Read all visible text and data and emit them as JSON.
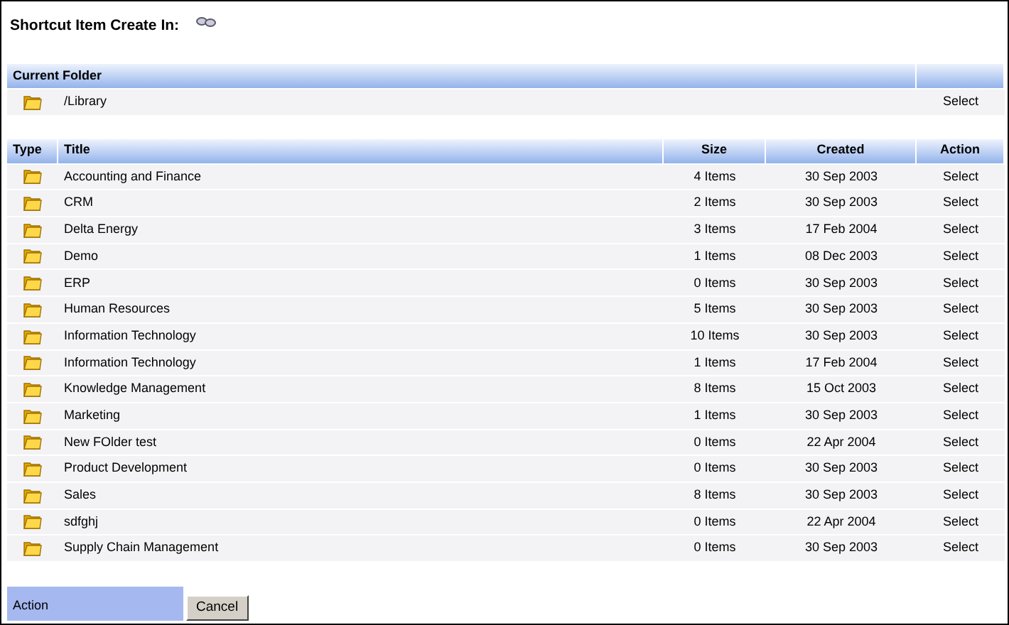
{
  "title": "Shortcut Item Create In:",
  "current_folder": {
    "heading": "Current Folder",
    "path": "/Library",
    "action": "Select"
  },
  "table": {
    "columns": [
      "Type",
      "Title",
      "Size",
      "Created",
      "Action"
    ],
    "rows": [
      {
        "title": "Accounting and Finance",
        "size": "4 Items",
        "created": "30 Sep 2003",
        "action": "Select"
      },
      {
        "title": "CRM",
        "size": "2 Items",
        "created": "30 Sep 2003",
        "action": "Select"
      },
      {
        "title": "Delta Energy",
        "size": "3 Items",
        "created": "17 Feb 2004",
        "action": "Select"
      },
      {
        "title": "Demo",
        "size": "1 Items",
        "created": "08 Dec 2003",
        "action": "Select"
      },
      {
        "title": "ERP",
        "size": "0 Items",
        "created": "30 Sep 2003",
        "action": "Select"
      },
      {
        "title": "Human Resources",
        "size": "5 Items",
        "created": "30 Sep 2003",
        "action": "Select"
      },
      {
        "title": "Information Technology",
        "size": "10 Items",
        "created": "30 Sep 2003",
        "action": "Select"
      },
      {
        "title": "Information Technology",
        "size": "1 Items",
        "created": "17 Feb 2004",
        "action": "Select"
      },
      {
        "title": "Knowledge Management",
        "size": "8 Items",
        "created": "15 Oct 2003",
        "action": "Select"
      },
      {
        "title": "Marketing",
        "size": "1 Items",
        "created": "30 Sep 2003",
        "action": "Select"
      },
      {
        "title": "New FOlder test",
        "size": "0 Items",
        "created": "22 Apr 2004",
        "action": "Select"
      },
      {
        "title": "Product Development",
        "size": "0 Items",
        "created": "30 Sep 2003",
        "action": "Select"
      },
      {
        "title": "Sales",
        "size": "8 Items",
        "created": "30 Sep 2003",
        "action": "Select"
      },
      {
        "title": "sdfghj",
        "size": "0 Items",
        "created": "22 Apr 2004",
        "action": "Select"
      },
      {
        "title": "Supply Chain Management",
        "size": "0 Items",
        "created": "30 Sep 2003",
        "action": "Select"
      }
    ]
  },
  "footer": {
    "label": "Action",
    "button": "Cancel"
  }
}
